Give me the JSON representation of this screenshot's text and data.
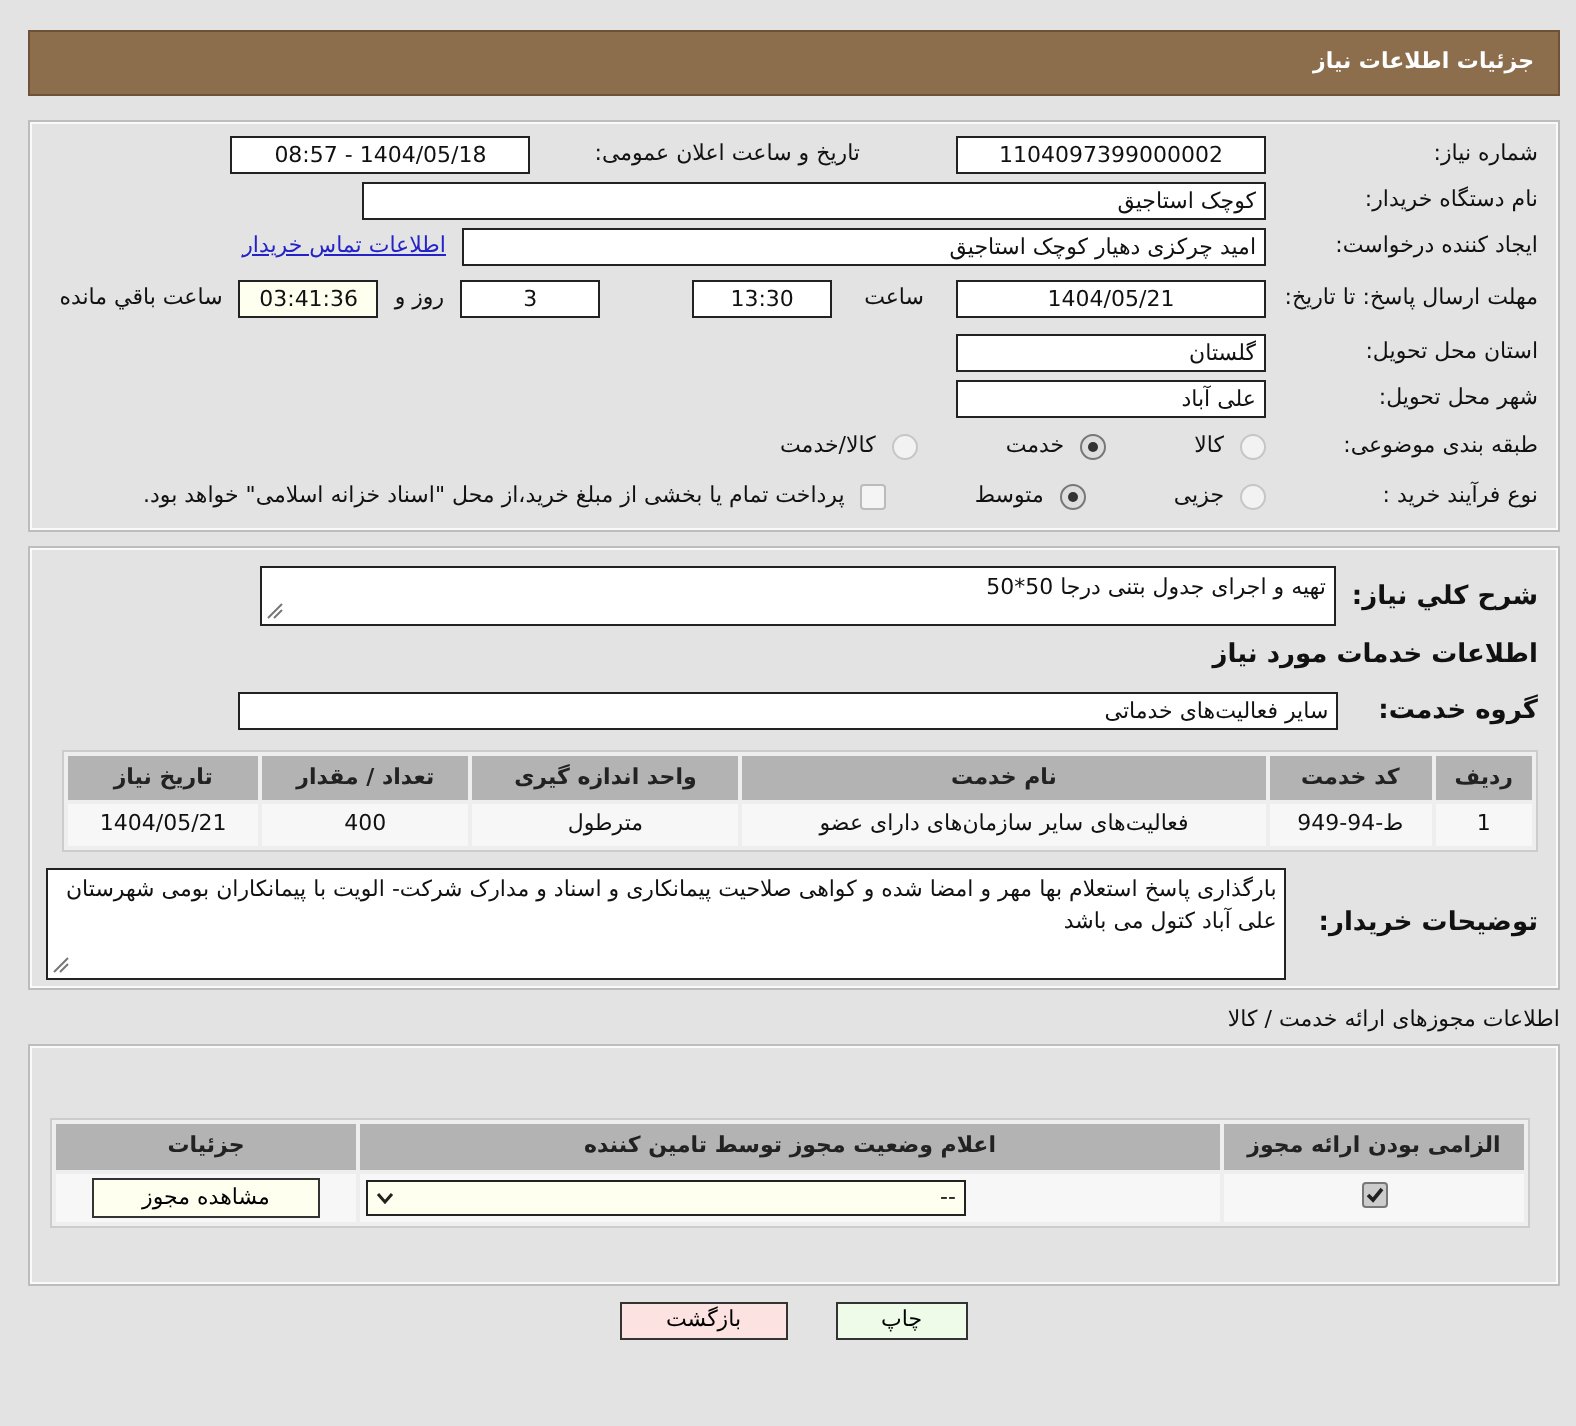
{
  "header": {
    "title": "جزئیات اطلاعات نیاز"
  },
  "need_number": {
    "label": "شماره نیاز:",
    "value": "1104097399000002"
  },
  "announce": {
    "label": "تاریخ و ساعت اعلان عمومی:",
    "value": "1404/05/18 - 08:57"
  },
  "buyer_org": {
    "label": "نام دستگاه خریدار:",
    "value": "کوچک استاجیق"
  },
  "requester": {
    "label": "ایجاد کننده درخواست:",
    "value": "امید چرکزی دهیار کوچک استاجیق",
    "link": "اطلاعات تماس خریدار"
  },
  "deadline": {
    "label": "مهلت ارسال پاسخ: تا تاریخ:",
    "date": "1404/05/21",
    "time_label": "ساعت",
    "time": "13:30",
    "days": "3",
    "days_label": "روز و",
    "remaining": "03:41:36",
    "remaining_label": "ساعت باقي مانده"
  },
  "province": {
    "label": "استان محل تحویل:",
    "value": "گلستان"
  },
  "city": {
    "label": "شهر محل تحویل:",
    "value": "علی آباد"
  },
  "category": {
    "label": "طبقه بندی موضوعی:",
    "options": [
      {
        "label": "کالا",
        "selected": false
      },
      {
        "label": "خدمت",
        "selected": true
      },
      {
        "label": "کالا/خدمت",
        "selected": false
      }
    ]
  },
  "purchase_type": {
    "label": "نوع فرآیند خرید :",
    "options": [
      {
        "label": "جزیی",
        "selected": false
      },
      {
        "label": "متوسط",
        "selected": true
      }
    ],
    "treasury": {
      "label": "پرداخت تمام یا بخشی از مبلغ خرید،از محل \"اسناد خزانه اسلامی\" خواهد بود.",
      "checked": false
    }
  },
  "description": {
    "label": "شرح کلي نیاز:",
    "value": "تهیه و اجرای جدول بتنی درجا 50*50"
  },
  "services_title": "اطلاعات خدمات مورد نیاز",
  "service_group": {
    "label": "گروه خدمت:",
    "value": "سایر فعالیت‌های خدماتی"
  },
  "services_table": {
    "columns": [
      "ردیف",
      "کد خدمت",
      "نام خدمت",
      "واحد اندازه گیری",
      "تعداد / مقدار",
      "تاریخ نیاز"
    ],
    "rows": [
      [
        "1",
        "ط-94-949",
        "فعالیت‌های سایر سازمان‌های دارای عضو",
        "مترطول",
        "400",
        "1404/05/21"
      ]
    ]
  },
  "buyer_notes": {
    "label": "توضیحات خریدار:",
    "value": "بارگذاری پاسخ استعلام بها مهر و امضا شده و کواهی صلاحیت پیمانکاری و اسناد و مدارک شرکت- الویت با پیمانکاران بومی شهرستان علی آباد کتول می باشد"
  },
  "permits": {
    "title": "اطلاعات مجوزهای ارائه خدمت / کالا",
    "columns": [
      "الزامی بودن ارائه مجوز",
      "اعلام وضعیت مجوز توسط تامین کننده",
      "جزئیات"
    ],
    "rows": [
      {
        "required": true,
        "status": "--",
        "action": "مشاهده مجوز"
      }
    ]
  },
  "buttons": [
    {
      "label": "چاپ",
      "kind": "print"
    },
    {
      "label": "بازگشت",
      "kind": "back"
    }
  ]
}
